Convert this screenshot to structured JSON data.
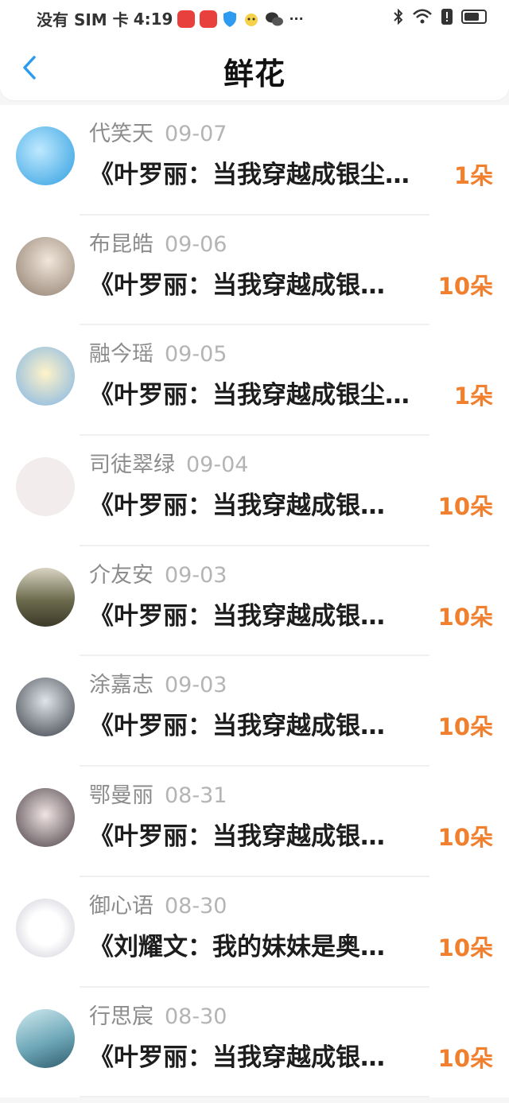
{
  "status_bar": {
    "carrier": "没有 SIM 卡",
    "time": "4:19",
    "more": "···"
  },
  "header": {
    "title": "鲜花"
  },
  "items": [
    {
      "name": "代笑天",
      "date": "09-07",
      "book": "《叶罗丽：当我穿越成银尘…",
      "count": "1朵"
    },
    {
      "name": "布昆皓",
      "date": "09-06",
      "book": "《叶罗丽：当我穿越成银…",
      "count": "10朵"
    },
    {
      "name": "融今瑶",
      "date": "09-05",
      "book": "《叶罗丽：当我穿越成银尘…",
      "count": "1朵"
    },
    {
      "name": "司徒翠绿",
      "date": "09-04",
      "book": "《叶罗丽：当我穿越成银…",
      "count": "10朵"
    },
    {
      "name": "介友安",
      "date": "09-03",
      "book": "《叶罗丽：当我穿越成银…",
      "count": "10朵"
    },
    {
      "name": "涂嘉志",
      "date": "09-03",
      "book": "《叶罗丽：当我穿越成银…",
      "count": "10朵"
    },
    {
      "name": "鄂曼丽",
      "date": "08-31",
      "book": "《叶罗丽：当我穿越成银…",
      "count": "10朵"
    },
    {
      "name": "御心语",
      "date": "08-30",
      "book": "《刘耀文：我的妹妹是奥…",
      "count": "10朵"
    },
    {
      "name": "行思宸",
      "date": "08-30",
      "book": "《叶罗丽：当我穿越成银…",
      "count": "10朵"
    }
  ],
  "colors": {
    "accent": "#f07f2e",
    "back": "#2d9cf0"
  }
}
